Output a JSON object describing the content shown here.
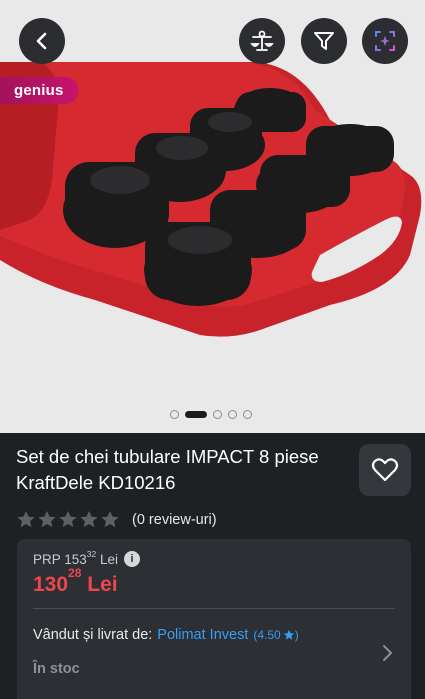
{
  "product": {
    "title": "Set de chei tubulare IMPACT 8 piese KraftDele KD10216",
    "review_count_text": "(0 review-uri)",
    "rating_stars": 0,
    "max_stars": 5
  },
  "badge": {
    "label": "genius"
  },
  "gallery": {
    "image_count": 5,
    "active_index": 1
  },
  "pricing": {
    "prp_label": "PRP 153",
    "prp_cents": "32",
    "prp_currency": "Lei",
    "price_main": "130",
    "price_cents": "28",
    "price_currency": "Lei"
  },
  "seller": {
    "prefix": "Vândut și livrat de:",
    "name": "Polimat Invest",
    "rating": "(4.50",
    "rating_suffix": ")"
  },
  "stock": {
    "status": "În stoc"
  },
  "icons": {
    "back": "chevron-left-icon",
    "compare": "compare-scale-icon",
    "filter": "send-arrow-icon",
    "ai": "ai-sparkle-icon",
    "favorite": "heart-icon",
    "info": "info-icon",
    "chevron": "chevron-right-icon"
  },
  "colors": {
    "price_red": "#f1454c",
    "link_blue": "#3a9cf2",
    "genius_magenta": "#c7146b",
    "background": "#1e2124"
  }
}
